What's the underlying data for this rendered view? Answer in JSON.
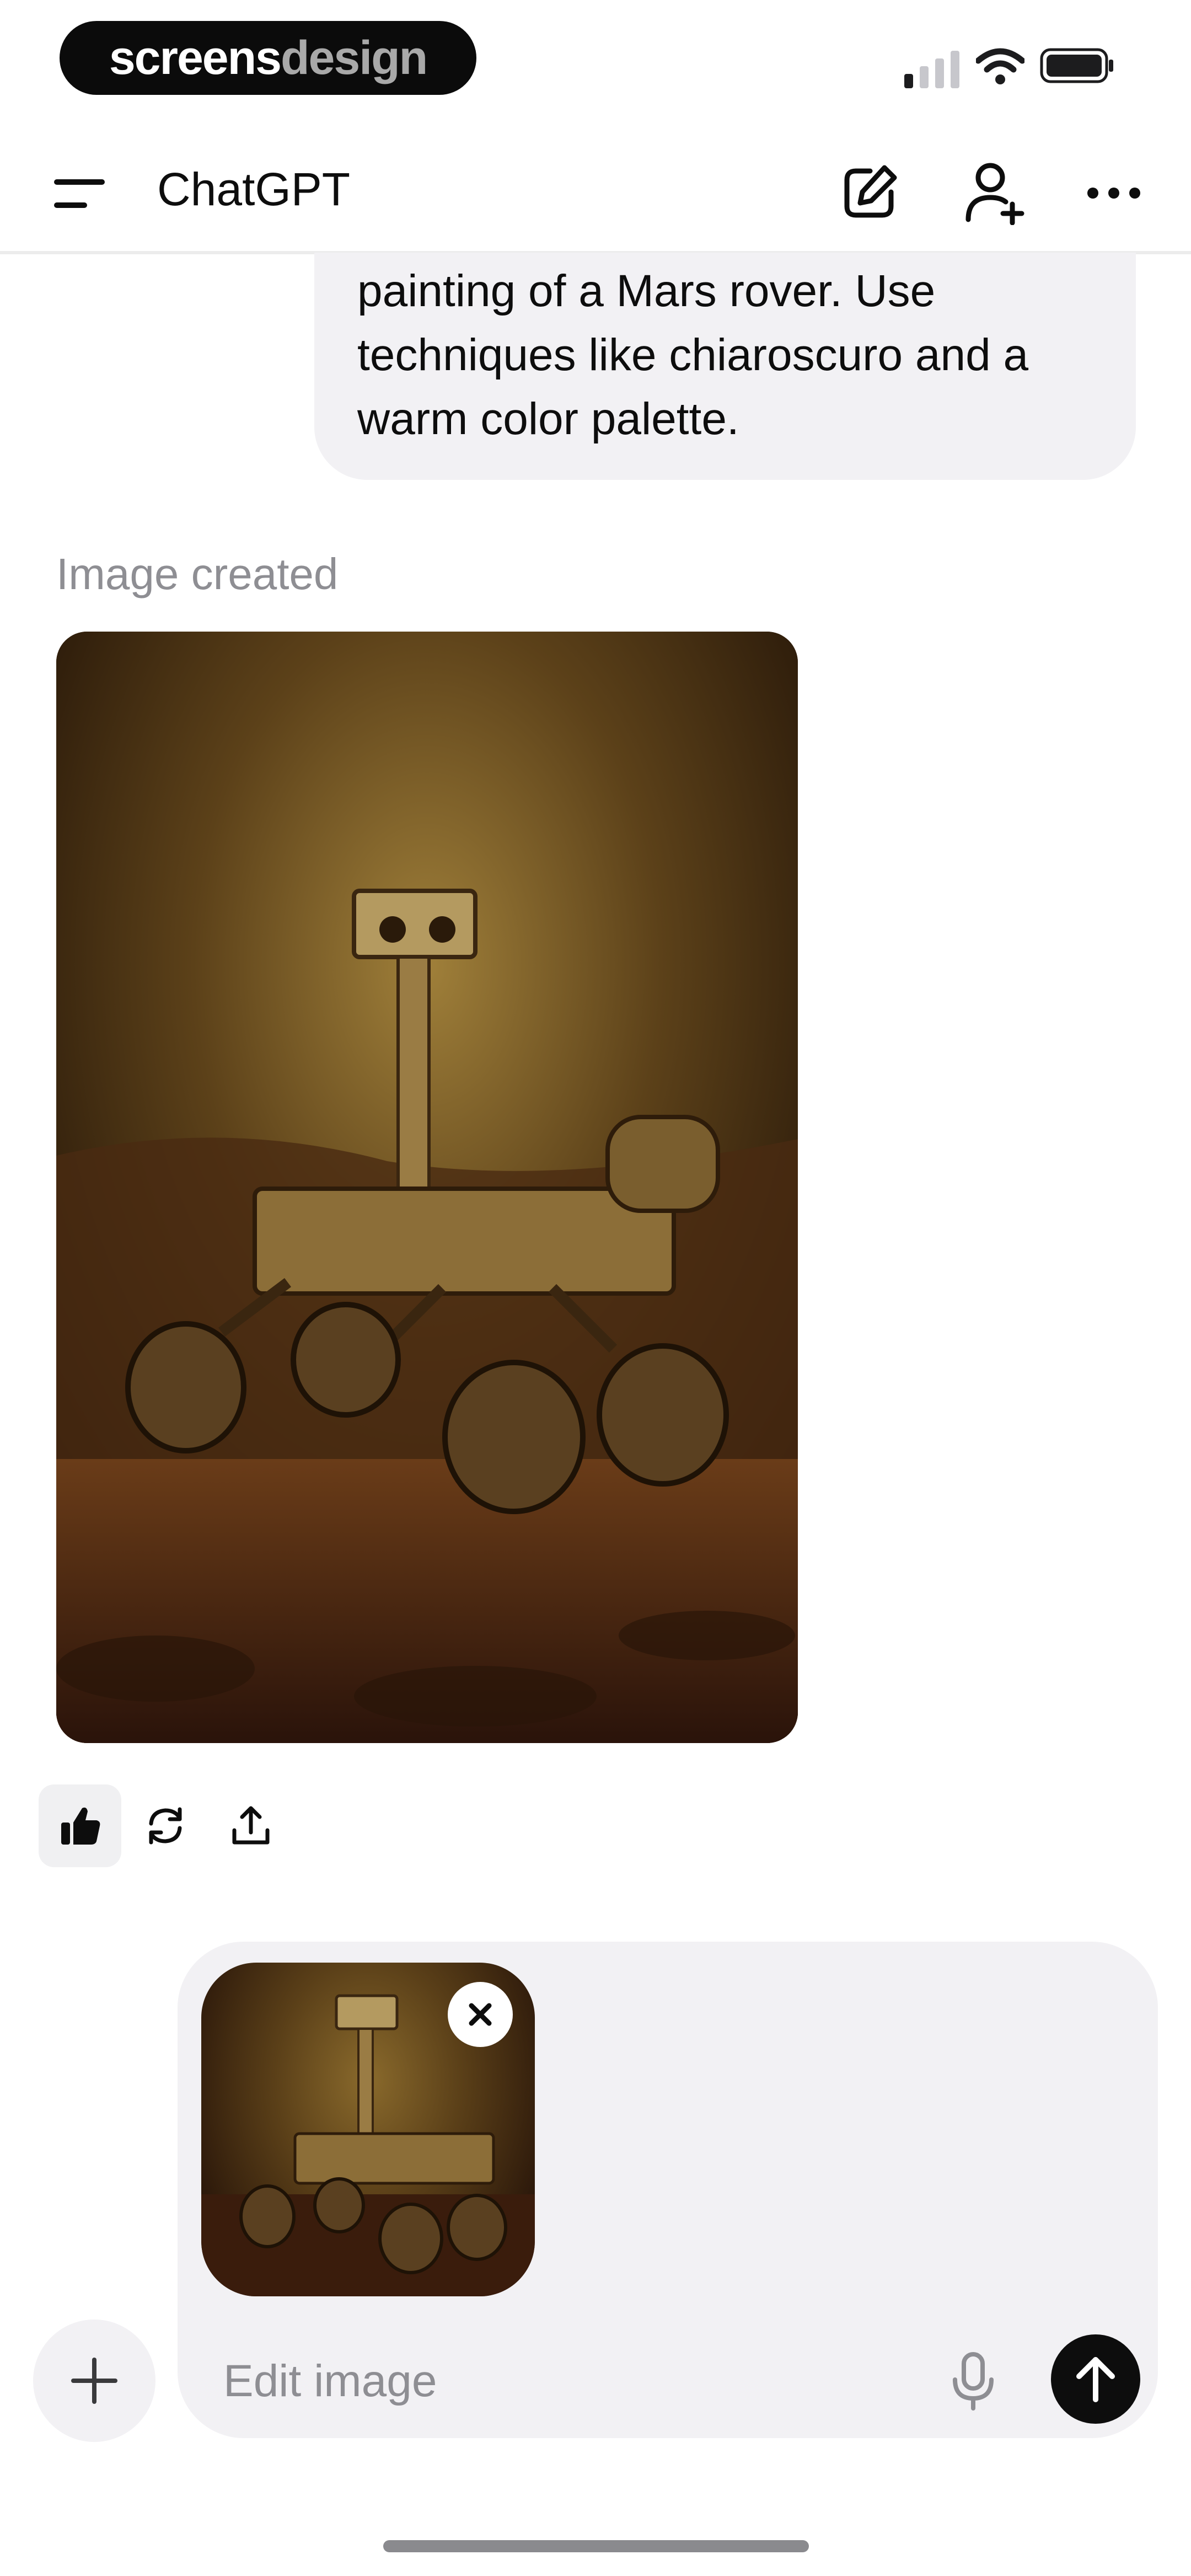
{
  "status_bar": {
    "brand_primary": "screens",
    "brand_secondary": "design",
    "signal_bars_active": 1,
    "signal_bars_total": 4
  },
  "header": {
    "title": "ChatGPT",
    "icons": [
      "menu-icon",
      "new-chat-icon",
      "add-people-icon",
      "more-icon"
    ]
  },
  "conversation": {
    "user_message_lines": [
      "painting of a Mars rover. Use",
      "techniques like chiaroscuro and a",
      "warm color palette."
    ],
    "assistant_label": "Image created",
    "actions": [
      "thumbs-up-icon",
      "regenerate-icon",
      "share-icon"
    ]
  },
  "composer": {
    "placeholder": "Edit image",
    "icons": [
      "plus-icon",
      "close-icon",
      "microphone-icon",
      "send-arrow-icon"
    ]
  },
  "colors": {
    "background": "#ffffff",
    "bubble": "#f2f1f4",
    "text": "#0d0d0d",
    "muted": "#8e8e93",
    "send_button": "#0d0d0d"
  }
}
